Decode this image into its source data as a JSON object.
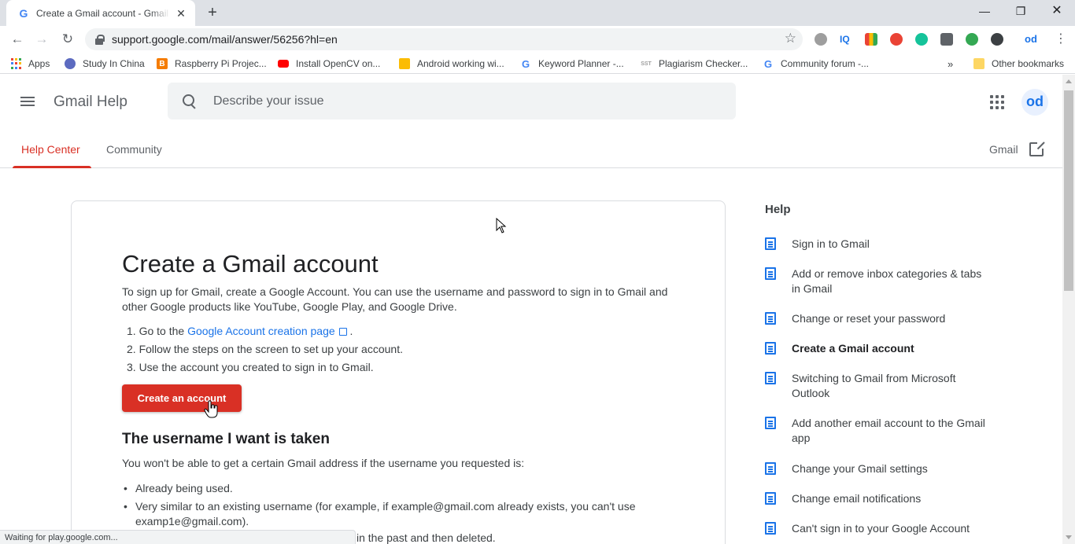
{
  "browser": {
    "tab_title": "Create a Gmail account - Gmail Help",
    "tab_favicon": "G",
    "url": "support.google.com/mail/answer/56256?hl=en",
    "bookmarks": [
      {
        "label": "Apps",
        "color": "#4285f4"
      },
      {
        "label": "Study In China",
        "color": "#5c6bc0"
      },
      {
        "label": "Raspberry Pi Projec...",
        "color": "#f57c00"
      },
      {
        "label": "Install OpenCV on...",
        "color": "#ff0000"
      },
      {
        "label": "Android working wi...",
        "color": "#fbbc04"
      },
      {
        "label": "Keyword Planner -...",
        "color": "#4285f4"
      },
      {
        "label": "Plagiarism Checker...",
        "color": "#9e9e9e"
      },
      {
        "label": "Community forum -...",
        "color": "#4285f4"
      }
    ],
    "bookmarks_overflow": "»",
    "other_bookmarks": "Other bookmarks",
    "status_text": "Waiting for play.google.com..."
  },
  "header": {
    "brand": "Gmail Help",
    "search_placeholder": "Describe your issue",
    "avatar_text": "od"
  },
  "subnav": {
    "tabs": [
      "Help Center",
      "Community"
    ],
    "gmail_link": "Gmail"
  },
  "article": {
    "title": "Create a Gmail account",
    "intro": "To sign up for Gmail, create a Google Account. You can use the username and password to sign in to Gmail and other Google products like YouTube, Google Play, and Google Drive.",
    "steps": {
      "s1_prefix": "1. Go to the ",
      "s1_link": "Google Account creation page",
      "s1_suffix": " .",
      "s2": "2. Follow the steps on the screen to set up your account.",
      "s3": "3. Use the account you created to sign in to Gmail."
    },
    "cta": "Create an account",
    "section2_title": "The username I want is taken",
    "section2_intro": "You won't be able to get a certain Gmail address if the username you requested is:",
    "bullets": [
      "Already being used.",
      "Very similar to an existing username (for example, if example@gmail.com already exists, you can't use examp1e@gmail.com)."
    ],
    "cut_line": "in the past and then deleted."
  },
  "sidebar": {
    "title": "Help",
    "items": [
      {
        "label": "Sign in to Gmail",
        "current": false
      },
      {
        "label": "Add or remove inbox categories & tabs in Gmail",
        "current": false
      },
      {
        "label": "Change or reset your password",
        "current": false
      },
      {
        "label": "Create a Gmail account",
        "current": true
      },
      {
        "label": "Switching to Gmail from Microsoft Outlook",
        "current": false
      },
      {
        "label": "Add another email account to the Gmail app",
        "current": false
      },
      {
        "label": "Change your Gmail settings",
        "current": false
      },
      {
        "label": "Change email notifications",
        "current": false
      },
      {
        "label": "Can't sign in to your Google Account",
        "current": false
      }
    ]
  },
  "colors": {
    "accent": "#d93025",
    "link": "#1a73e8"
  }
}
